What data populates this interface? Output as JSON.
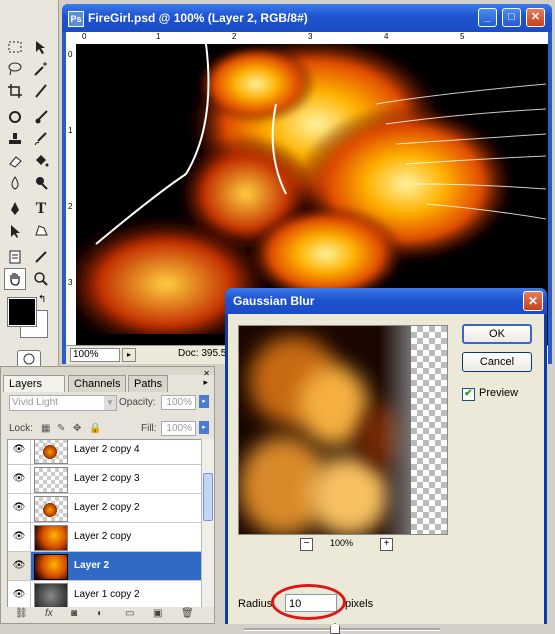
{
  "document": {
    "title": "FireGirl.psd @ 100% (Layer 2, RGB/8#)",
    "zoom": "100%",
    "doc_info": "Doc: 395.5",
    "ruler_h": [
      "0",
      "1",
      "2",
      "3",
      "4",
      "5"
    ],
    "ruler_v": [
      "0",
      "1",
      "2",
      "3"
    ]
  },
  "layers_panel": {
    "tabs": [
      "Layers",
      "Channels",
      "Paths"
    ],
    "blend_mode": "Vivid Light",
    "opacity_label": "Opacity:",
    "opacity_value": "100%",
    "lock_label": "Lock:",
    "fill_label": "Fill:",
    "fill_value": "100%",
    "layers": [
      {
        "name": "Layer 2 copy 4",
        "thumb": "partial",
        "selected": false
      },
      {
        "name": "Layer 2 copy 3",
        "thumb": "transparent",
        "selected": false
      },
      {
        "name": "Layer 2 copy 2",
        "thumb": "partial",
        "selected": false
      },
      {
        "name": "Layer 2 copy",
        "thumb": "fire",
        "selected": false
      },
      {
        "name": "Layer 2",
        "thumb": "fire",
        "selected": true
      },
      {
        "name": "Layer 1 copy 2",
        "thumb": "fire",
        "selected": false
      }
    ]
  },
  "gaussian_blur": {
    "title": "Gaussian Blur",
    "ok_label": "OK",
    "cancel_label": "Cancel",
    "preview_label": "Preview",
    "preview_checked": true,
    "zoom": "100%",
    "radius_label": "Radius:",
    "radius_value": "10",
    "units": "pixels",
    "slider_fraction": 0.46
  },
  "colors": {
    "xp_title_blue": "#1e53d0",
    "selection_blue": "#316ac5",
    "highlight_red": "#e01515"
  }
}
